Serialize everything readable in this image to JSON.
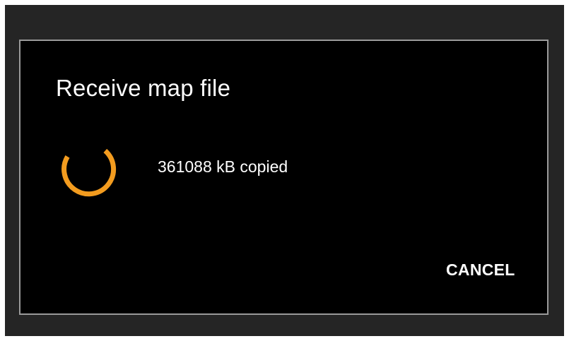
{
  "dialog": {
    "title": "Receive map file",
    "status_text": "361088 kB copied",
    "cancel_label": "CANCEL",
    "spinner_icon": "spinner-icon"
  },
  "colors": {
    "spinner": "#f39c1f",
    "dialog_background": "#000000",
    "dialog_border": "#9a9a9a",
    "screen_background": "#252525",
    "text": "#ffffff"
  }
}
